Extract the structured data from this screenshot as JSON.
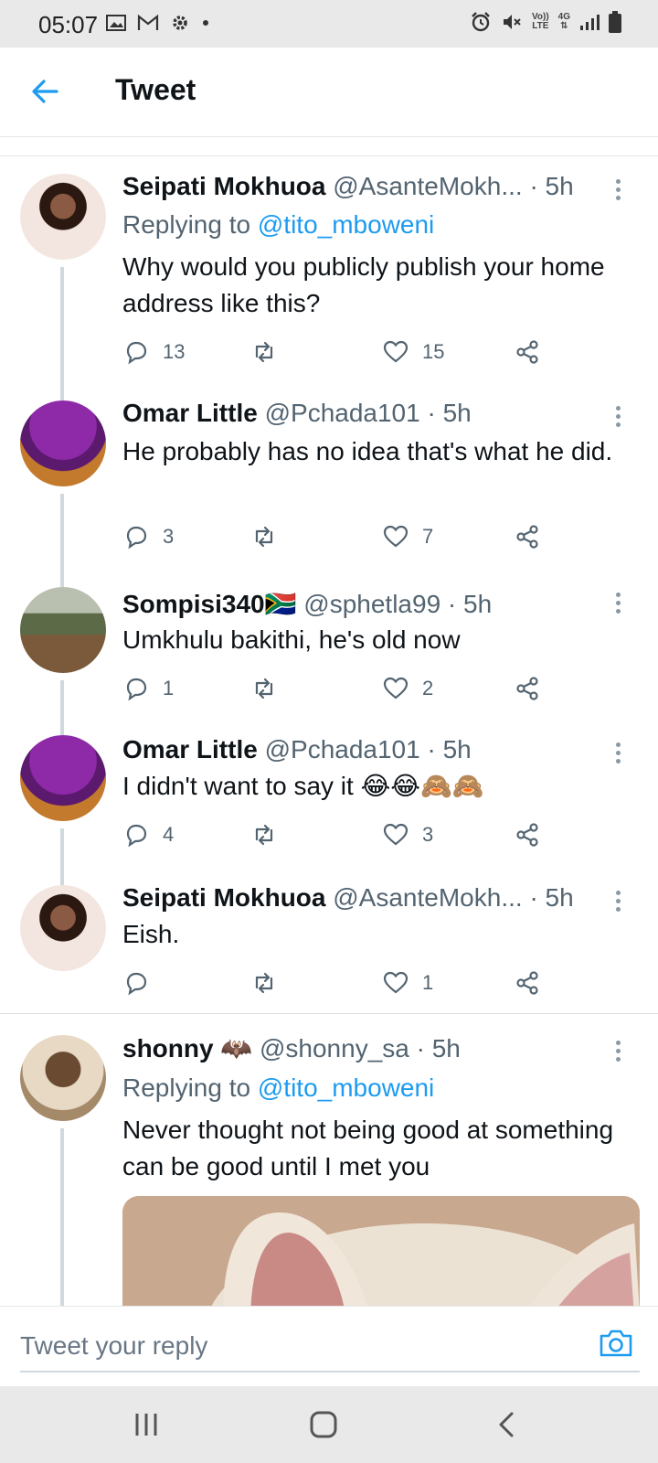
{
  "status_bar": {
    "time": "05:07",
    "left_icons": [
      "image-icon",
      "gmail-icon",
      "settings-icon",
      "dot-icon"
    ],
    "right_icons": [
      "alarm-icon",
      "mute-icon",
      "volte-icon",
      "4g-icon",
      "signal-icon",
      "battery-icon"
    ],
    "volte_label_top": "Vo))",
    "volte_label_bottom": "LTE",
    "net_label": "4G"
  },
  "header": {
    "title": "Tweet",
    "back_icon": "back-arrow-icon"
  },
  "tweets": [
    {
      "name": "Seipati Mokhuoa",
      "handle": "@AsanteMokh...",
      "time": "· 5h",
      "replying_prefix": "Replying to",
      "replying_to": "@tito_mboweni",
      "text": "Why would you publicly publish your home address like this?",
      "replies": "13",
      "retweets": "",
      "likes": "15"
    },
    {
      "name": "Omar Little",
      "handle": "@Pchada101",
      "time": "· 5h",
      "text": "He probably has no idea that's what he did.",
      "replies": "3",
      "retweets": "",
      "likes": "7"
    },
    {
      "name": "Sompisi340🇿🇦",
      "handle": "@sphetla99",
      "time": "· 5h",
      "text": "Umkhulu bakithi, he's old now",
      "replies": "1",
      "retweets": "",
      "likes": "2"
    },
    {
      "name": "Omar Little",
      "handle": "@Pchada101",
      "time": "· 5h",
      "text": "I didn't want to say it 😂😂🙈🙈",
      "replies": "4",
      "retweets": "",
      "likes": "3"
    },
    {
      "name": "Seipati Mokhuoa",
      "handle": "@AsanteMokh...",
      "time": "· 5h",
      "text": "Eish.",
      "replies": "",
      "retweets": "",
      "likes": "1"
    },
    {
      "name": "shonny 🦇",
      "handle": "@shonny_sa",
      "time": "· 5h",
      "replying_prefix": "Replying to",
      "replying_to": "@tito_mboweni",
      "text": "Never thought not being good at something can be good until I met you"
    }
  ],
  "reply_bar": {
    "placeholder": "Tweet your reply",
    "camera_icon": "camera-icon"
  },
  "nav_bar": {
    "icons": [
      "recent-apps-icon",
      "home-icon",
      "back-icon"
    ]
  },
  "colors": {
    "accent": "#1d9bf0",
    "text": "#0f1419",
    "secondary": "#536471",
    "thread_line": "#cfd9de"
  }
}
